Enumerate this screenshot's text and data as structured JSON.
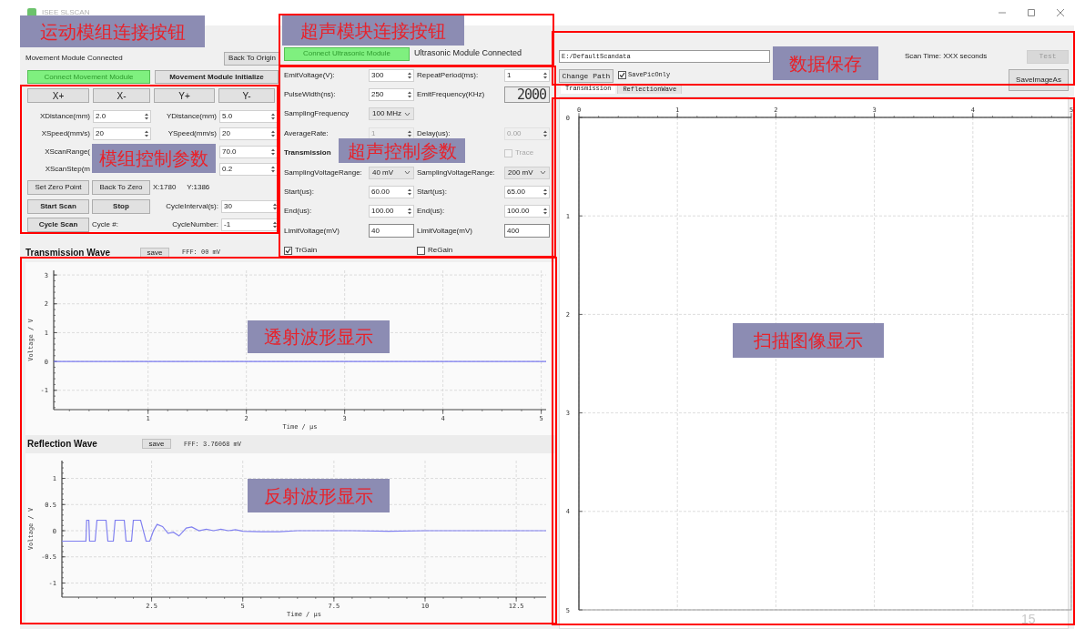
{
  "window": {
    "title": "ISEE SLSCAN"
  },
  "movement": {
    "status": "Movement Module Connected",
    "back_to_origin": "Back To Origin",
    "connect_button": {
      "label": "Connect Movement Module",
      "connected": true
    },
    "initialize_button": "Movement Module Initialize",
    "direction_buttons": [
      "X+",
      "X-",
      "Y+",
      "Y-"
    ],
    "rows": [
      {
        "left_label": {
          "kind": "label",
          "text": "XDistance(mm)"
        },
        "left_field": {
          "kind": "spin",
          "value": "2.0",
          "disabled": false
        },
        "right_label": {
          "kind": "label",
          "text": "YDistance(mm)"
        },
        "right_field": {
          "kind": "spin",
          "value": "5.0",
          "disabled": false
        }
      },
      {
        "left_label": {
          "kind": "label",
          "text": "XSpeed(mm/s)"
        },
        "left_field": {
          "kind": "spin",
          "value": "20",
          "disabled": false
        },
        "right_label": {
          "kind": "label",
          "text": "YSpeed(mm/s)"
        },
        "right_field": {
          "kind": "spin",
          "value": "20",
          "disabled": false
        }
      },
      {
        "left_label": {
          "kind": "label",
          "text": "XScanRange("
        },
        "right_field": {
          "kind": "spin",
          "value": "70.0",
          "disabled": false
        }
      },
      {
        "left_label": {
          "kind": "label",
          "text": "XScanStep(m"
        },
        "right_field": {
          "kind": "spin",
          "value": "0.2",
          "disabled": false
        }
      },
      {
        "left_label": {
          "kind": "button",
          "text": "Set Zero Point",
          "bold": false
        },
        "left_field": {
          "kind": "button",
          "text": "Back To Zero",
          "bold": false
        },
        "right_label": [
          {
            "kind": "text",
            "text": "X:1780"
          },
          {
            "kind": "text",
            "text": "Y:1386"
          }
        ]
      },
      {
        "left_label": {
          "kind": "button",
          "text": "Start Scan",
          "bold": true
        },
        "left_field": {
          "kind": "button",
          "text": "Stop",
          "bold": true
        },
        "right_label": {
          "kind": "label",
          "text": "CycleInterval(s):"
        },
        "right_field": {
          "kind": "spin",
          "value": "30",
          "disabled": false
        }
      },
      {
        "left_label": {
          "kind": "button",
          "text": "Cycle Scan",
          "bold": true
        },
        "left_field": {
          "kind": "text",
          "text": "Cycle #:"
        },
        "right_label": {
          "kind": "label",
          "text": "CycleNumber:"
        },
        "right_field": {
          "kind": "spin",
          "value": "-1",
          "disabled": false
        }
      }
    ]
  },
  "ultrasonic": {
    "connect_button": {
      "label": "Connect Ultrasonic Module",
      "connected": true
    },
    "status": "Ultrasonic Module Connected",
    "rows": [
      {
        "left_label": {
          "kind": "label",
          "text": "EmitVoltage(V):"
        },
        "left_field": {
          "kind": "spin",
          "value": "300",
          "disabled": false
        },
        "right_label": {
          "kind": "label",
          "text": "RepeatPeriod(ms):"
        },
        "right_field": {
          "kind": "spin",
          "value": "1",
          "disabled": false
        }
      },
      {
        "left_label": {
          "kind": "label",
          "text": "PulseWidth(ns):"
        },
        "left_field": {
          "kind": "spin",
          "value": "250",
          "disabled": false
        },
        "right_label": {
          "kind": "label",
          "text": "EmitFrequency(KHz)"
        },
        "right_field": {
          "kind": "lcd",
          "value": "2000"
        }
      },
      {
        "left_label": {
          "kind": "label",
          "text": "SamplingFrequency"
        },
        "left_field": {
          "kind": "combo",
          "value": "100 MHz",
          "disabled": false
        }
      },
      {
        "left_label": {
          "kind": "label",
          "text": "AverageRate:"
        },
        "left_field": {
          "kind": "spin",
          "value": "1",
          "disabled": true
        },
        "right_label": {
          "kind": "label",
          "text": "Delay(us):"
        },
        "right_field": {
          "kind": "spin",
          "value": "0.00",
          "disabled": true
        }
      },
      {
        "left_label": {
          "kind": "heading",
          "text": "Transmission"
        },
        "right_field": {
          "kind": "checkbox",
          "label": "Trace",
          "checked": false,
          "disabled": true
        }
      },
      {
        "left_label": {
          "kind": "label",
          "text": "SamplingVoltageRange:"
        },
        "left_field": {
          "kind": "combo",
          "value": "40 mV",
          "disabled": false
        },
        "right_label": {
          "kind": "label",
          "text": "SamplingVoltageRange:"
        },
        "right_field": {
          "kind": "combo",
          "value": "200 mV",
          "disabled": false
        }
      },
      {
        "left_label": {
          "kind": "label",
          "text": "Start(us):"
        },
        "left_field": {
          "kind": "spin",
          "value": "60.00",
          "disabled": false
        },
        "right_label": {
          "kind": "label",
          "text": "Start(us):"
        },
        "right_field": {
          "kind": "spin",
          "value": "65.00",
          "disabled": false
        }
      },
      {
        "left_label": {
          "kind": "label",
          "text": "End(us):"
        },
        "left_field": {
          "kind": "spin",
          "value": "100.00",
          "disabled": false
        },
        "right_label": {
          "kind": "label",
          "text": "End(us):"
        },
        "right_field": {
          "kind": "spin",
          "value": "100.00",
          "disabled": false
        }
      },
      {
        "left_label": {
          "kind": "label",
          "text": "LimitVoltage(mV)"
        },
        "left_field": {
          "kind": "field",
          "value": "40"
        },
        "right_label": {
          "kind": "label",
          "text": "LimitVoltage(mV)"
        },
        "right_field": {
          "kind": "field",
          "value": "400"
        }
      },
      {
        "left_label": {
          "kind": "checkbox",
          "label": "TrGain",
          "checked": true,
          "disabled": false
        },
        "right_label": {
          "kind": "checkbox",
          "label": "ReGain",
          "checked": false,
          "disabled": false
        }
      }
    ]
  },
  "data_save": {
    "path": "E:/DefaultScandata",
    "scan_time": "Scan Time: XXX seconds",
    "test_button": {
      "label": "Test",
      "disabled": true
    },
    "change_path": "Change Path",
    "save_pic_only": {
      "label": "SavePicOnly",
      "checked": true
    },
    "save_image_as": "SaveImageAs",
    "tabs": [
      {
        "label": "Transmission",
        "selected": true
      },
      {
        "label": "ReflectionWave",
        "selected": false
      }
    ],
    "chart_data": {
      "type": "scatter",
      "grid": true,
      "xlim": [
        0,
        5
      ],
      "ylim": [
        5,
        0
      ],
      "xticks": [
        0,
        1,
        2,
        3,
        4,
        5
      ],
      "yticks": [
        0,
        1,
        2,
        3,
        4,
        5
      ]
    }
  },
  "transmission_wave": {
    "title": "Transmission Wave",
    "save": "save",
    "fff": "FFF: 00 mV",
    "chart_data": {
      "type": "line",
      "grid": true,
      "xlabel": "Time / μs",
      "ylabel": "Voltage / V",
      "x": [
        0.04,
        5.05
      ],
      "series": [
        {
          "color": "#7a7af0",
          "values": [
            0,
            0
          ]
        }
      ],
      "xlim": [
        0.04,
        5.05
      ],
      "ylim": [
        -1.67,
        3.16
      ],
      "xticks": [
        1,
        2,
        3,
        4,
        5
      ],
      "yticks": [
        -1,
        0,
        1,
        2,
        3
      ]
    }
  },
  "reflection_wave": {
    "title": "Reflection Wave",
    "save": "save",
    "fff": "FFF: 3.76068 mV",
    "chart_data": {
      "type": "line",
      "grid": true,
      "xlabel": "Time / μs",
      "ylabel": "Voltage / V",
      "x": [
        0.04,
        0.7,
        0.72,
        0.78,
        0.8,
        0.95,
        1.0,
        1.25,
        1.3,
        1.45,
        1.5,
        1.75,
        1.8,
        1.95,
        2.0,
        2.2,
        2.35,
        2.45,
        2.55,
        2.65,
        2.8,
        2.95,
        3.1,
        3.25,
        3.45,
        3.6,
        3.8,
        4.0,
        4.2,
        4.4,
        4.6,
        4.8,
        5.0,
        5.5,
        6.0,
        6.5,
        7.0,
        8.0,
        9.0,
        10.0,
        11.0,
        12.0,
        13.32
      ],
      "series": [
        {
          "color": "#8080f0",
          "values": [
            -0.2,
            -0.2,
            0.2,
            0.2,
            -0.2,
            -0.2,
            0.2,
            0.2,
            -0.2,
            -0.2,
            0.2,
            0.2,
            -0.2,
            -0.2,
            0.2,
            0.2,
            -0.2,
            -0.2,
            0.0,
            0.12,
            0.08,
            -0.05,
            -0.03,
            -0.1,
            0.05,
            0.07,
            0.0,
            0.03,
            0.0,
            0.03,
            0.0,
            0.02,
            -0.01,
            -0.02,
            -0.02,
            0.0,
            0.0,
            0.0,
            -0.01,
            0.0,
            0.0,
            0.0,
            0.0
          ]
        }
      ],
      "xlim": [
        0.04,
        13.32
      ],
      "ylim": [
        -1.27,
        1.34
      ],
      "xticks": [
        2.5,
        5,
        7.5,
        10,
        12.5
      ],
      "yticks": [
        -1,
        -0.5,
        0,
        0.5,
        1
      ]
    }
  },
  "annotations": [
    "运动模组连接按钮",
    "超声模块连接按钮",
    "模组控制参数",
    "超声控制参数",
    "数据保存",
    "透射波形显示",
    "反射波形显示",
    "扫描图像显示"
  ],
  "page_number": "15"
}
